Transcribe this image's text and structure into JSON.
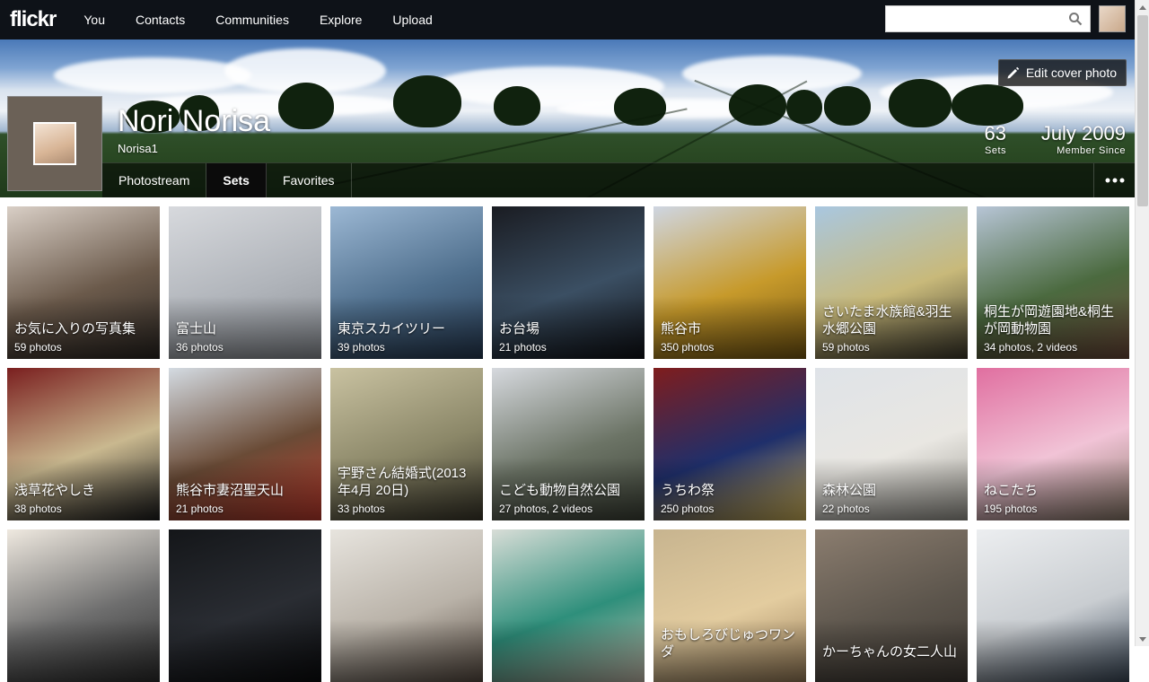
{
  "header": {
    "logo": "flickr",
    "nav": [
      "You",
      "Contacts",
      "Communities",
      "Explore",
      "Upload"
    ],
    "search_value": ""
  },
  "profile": {
    "name": "Nori Norisa",
    "username": "Norisa1",
    "edit_cover_label": "Edit cover photo",
    "stats": {
      "sets": {
        "value": "63",
        "label": "Sets"
      },
      "member": {
        "value": "July 2009",
        "label": "Member Since"
      }
    },
    "tabs": [
      "Photostream",
      "Sets",
      "Favorites"
    ],
    "active_tab": "Sets"
  },
  "sets": [
    {
      "title": "お気に入りの写真集",
      "count": "59 photos",
      "colors": [
        "#d9cfc6",
        "#6b5a4b",
        "#2b2622"
      ]
    },
    {
      "title": "富士山",
      "count": "36 photos",
      "colors": [
        "#d7d9dd",
        "#b0b4ba",
        "#8d9197"
      ]
    },
    {
      "title": "東京スカイツリー",
      "count": "39 photos",
      "colors": [
        "#9cb8d4",
        "#4f6f8d",
        "#263a52"
      ]
    },
    {
      "title": "お台場",
      "count": "21 photos",
      "colors": [
        "#1a1c22",
        "#3b4f63",
        "#101217"
      ]
    },
    {
      "title": "熊谷市",
      "count": "350 photos",
      "colors": [
        "#cfd6e2",
        "#c79a2b",
        "#7a5a12"
      ]
    },
    {
      "title": "さいたま水族館&羽生 水郷公園",
      "count": "59 photos",
      "colors": [
        "#a9c7e0",
        "#c8b97a",
        "#3e3a2c"
      ]
    },
    {
      "title": "桐生が岡遊園地&桐生 が岡動物園",
      "count": "34 photos, 2 videos",
      "colors": [
        "#b7c5d6",
        "#4b6a3f",
        "#6d4a3a"
      ]
    },
    {
      "title": "浅草花やしき",
      "count": "38 photos",
      "colors": [
        "#7a1f1f",
        "#c9b88f",
        "#1c1c1c"
      ]
    },
    {
      "title": "熊谷市妻沼聖天山",
      "count": "21 photos",
      "colors": [
        "#d4dbe2",
        "#6a4b36",
        "#c23c2e"
      ]
    },
    {
      "title": "宇野さん結婚式(2013 年4月 20日)",
      "count": "33 photos",
      "colors": [
        "#c9c2a1",
        "#8b8768",
        "#3b382b"
      ]
    },
    {
      "title": "こども動物自然公園",
      "count": "27 photos, 2 videos",
      "colors": [
        "#d6d9de",
        "#6c7466",
        "#3c4136"
      ]
    },
    {
      "title": "うちわ祭",
      "count": "250 photos",
      "colors": [
        "#7f1d1d",
        "#1f2f6b",
        "#d6b85a"
      ]
    },
    {
      "title": "森林公園",
      "count": "22 photos",
      "colors": [
        "#dfe3e8",
        "#e9e7e2",
        "#9a9890"
      ]
    },
    {
      "title": "ねこたち",
      "count": "195 photos",
      "colors": [
        "#e06fa0",
        "#f1c3d6",
        "#8a7a6a"
      ]
    },
    {
      "title": "",
      "count": "",
      "colors": [
        "#efe9e0",
        "#6e6e6e",
        "#2c2c2c"
      ]
    },
    {
      "title": "",
      "count": "",
      "colors": [
        "#141619",
        "#2a2d33",
        "#0b0c0e"
      ]
    },
    {
      "title": "",
      "count": "",
      "colors": [
        "#e7e4de",
        "#b9b2a8",
        "#5a4e44"
      ]
    },
    {
      "title": "",
      "count": "",
      "colors": [
        "#d8ddd7",
        "#2e8f7b",
        "#c9c0b0"
      ]
    },
    {
      "title": "おもしろびじゅつワンダ",
      "count": "",
      "colors": [
        "#c7b48f",
        "#e3cc9f",
        "#9b7f5a"
      ]
    },
    {
      "title": "かーちゃんの女二人山",
      "count": "",
      "colors": [
        "#8b7d6f",
        "#5c554c",
        "#403a34"
      ]
    },
    {
      "title": "",
      "count": "",
      "colors": [
        "#eceef0",
        "#c9cdd1",
        "#3c4a5a"
      ]
    }
  ]
}
